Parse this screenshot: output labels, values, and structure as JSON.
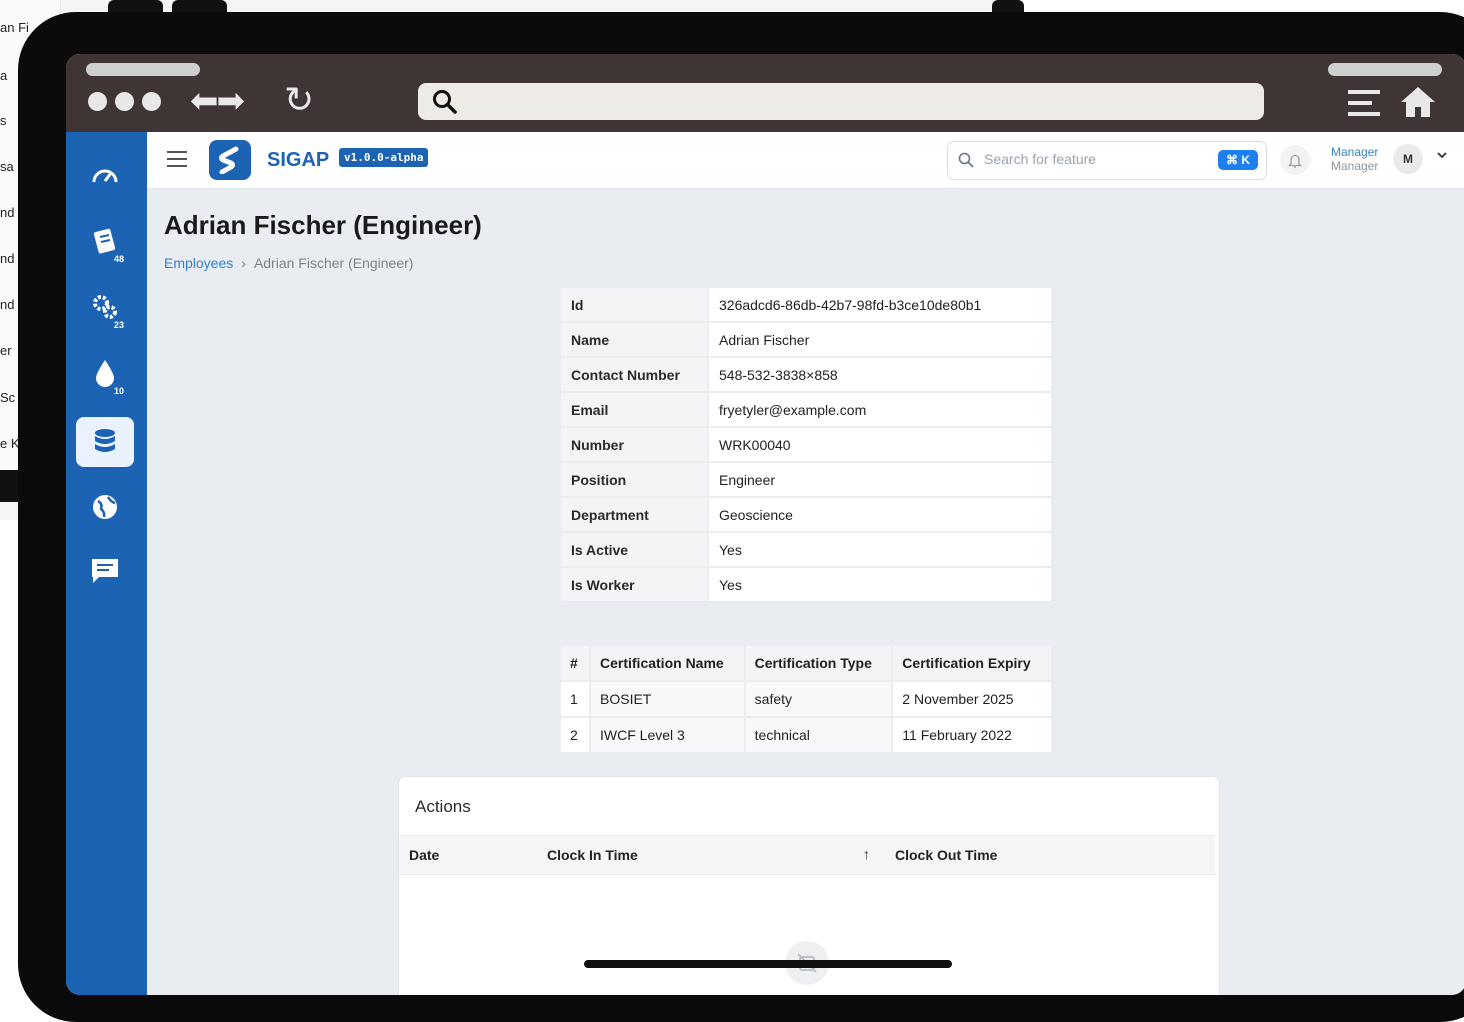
{
  "background_window": {
    "rows": [
      "an Fi",
      "a",
      "s",
      "sa",
      "nd",
      "nd",
      "nd",
      "er",
      "Sc",
      "e K"
    ]
  },
  "browser": {
    "search_icon": "search-icon",
    "address": ""
  },
  "sidebar": {
    "items": [
      {
        "icon": "gauge-icon",
        "badge": ""
      },
      {
        "icon": "clipboard-icon",
        "badge": "48"
      },
      {
        "icon": "gears-icon",
        "badge": "23"
      },
      {
        "icon": "drop-icon",
        "badge": "10"
      },
      {
        "icon": "database-icon",
        "badge": "",
        "active": true
      },
      {
        "icon": "globe-icon",
        "badge": ""
      },
      {
        "icon": "chat-icon",
        "badge": ""
      }
    ]
  },
  "header": {
    "brand": "SIGAP",
    "version": "v1.0.0-alpha",
    "search_placeholder": "Search for feature",
    "shortcut": "⌘ K",
    "user_name": "Manager",
    "user_role": "Manager",
    "avatar_initial": "M"
  },
  "page": {
    "title": "Adrian Fischer (Engineer)",
    "breadcrumb": {
      "parent": "Employees",
      "separator": "›",
      "current": "Adrian Fischer (Engineer)"
    }
  },
  "details": [
    {
      "label": "Id",
      "value": "326adcd6-86db-42b7-98fd-b3ce10de80b1"
    },
    {
      "label": "Name",
      "value": "Adrian Fischer"
    },
    {
      "label": "Contact Number",
      "value": "548-532-3838×858"
    },
    {
      "label": "Email",
      "value": "fryetyler@example.com"
    },
    {
      "label": "Number",
      "value": "WRK00040"
    },
    {
      "label": "Position",
      "value": "Engineer"
    },
    {
      "label": "Department",
      "value": "Geoscience"
    },
    {
      "label": "Is Active",
      "value": "Yes"
    },
    {
      "label": "Is Worker",
      "value": "Yes"
    }
  ],
  "certifications": {
    "headers": [
      "#",
      "Certification Name",
      "Certification Type",
      "Certification Expiry"
    ],
    "rows": [
      [
        "1",
        "BOSIET",
        "safety",
        "2 November 2025"
      ],
      [
        "2",
        "IWCF Level 3",
        "technical",
        "11 February 2022"
      ]
    ]
  },
  "actions": {
    "title": "Actions",
    "columns": [
      "Date",
      "Clock In Time",
      "Clock Out Time"
    ],
    "sort_indicator": "↑"
  },
  "colors": {
    "brand_blue": "#1c63b3",
    "link_blue": "#2f7fd6",
    "chrome": "#3f3535"
  }
}
